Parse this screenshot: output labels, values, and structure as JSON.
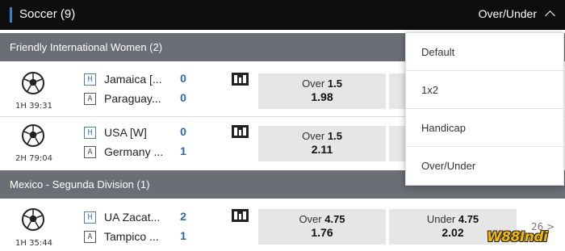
{
  "header": {
    "sport_title": "Soccer (9)",
    "market_label": "Over/Under"
  },
  "leagues": [
    {
      "name": "Friendly International Women (2)"
    },
    {
      "name": "Mexico - Segunda Division (1)"
    }
  ],
  "matches": [
    {
      "clock": "1H 39:31",
      "home_badge": "H",
      "away_badge": "A",
      "home": "Jamaica [...",
      "away": "Paraguay...",
      "home_score": "0",
      "away_score": "0",
      "odds_a": {
        "label": "Over",
        "line": "1.5",
        "price": "1.98"
      }
    },
    {
      "clock": "2H 79:04",
      "home_badge": "H",
      "away_badge": "A",
      "home": "USA [W]",
      "away": "Germany ...",
      "home_score": "0",
      "away_score": "1",
      "odds_a": {
        "label": "Over",
        "line": "1.5",
        "price": "2.11"
      }
    },
    {
      "clock": "1H 35:44",
      "home_badge": "H",
      "away_badge": "A",
      "home": "UA Zacat...",
      "away": "Tampico ...",
      "home_score": "2",
      "away_score": "1",
      "odds_a": {
        "label": "Over",
        "line": "4.75",
        "price": "1.76"
      },
      "odds_b": {
        "label": "Under",
        "line": "4.75",
        "price": "2.02"
      }
    }
  ],
  "pager": "26 >",
  "dropdown": {
    "options": [
      "Default",
      "1x2",
      "Handicap",
      "Over/Under"
    ]
  },
  "watermark": "W88Indi",
  "colors": {
    "topbar": "#0e0e0e",
    "accent": "#2c86c9",
    "league_bar": "#6b6e75",
    "score": "#2a6aa8",
    "odds_bg": "#e6e6e6"
  },
  "icons": {
    "sport": "soccer-ball-icon",
    "stats": "stats-icon",
    "dropdown": "chevron-up-icon"
  }
}
